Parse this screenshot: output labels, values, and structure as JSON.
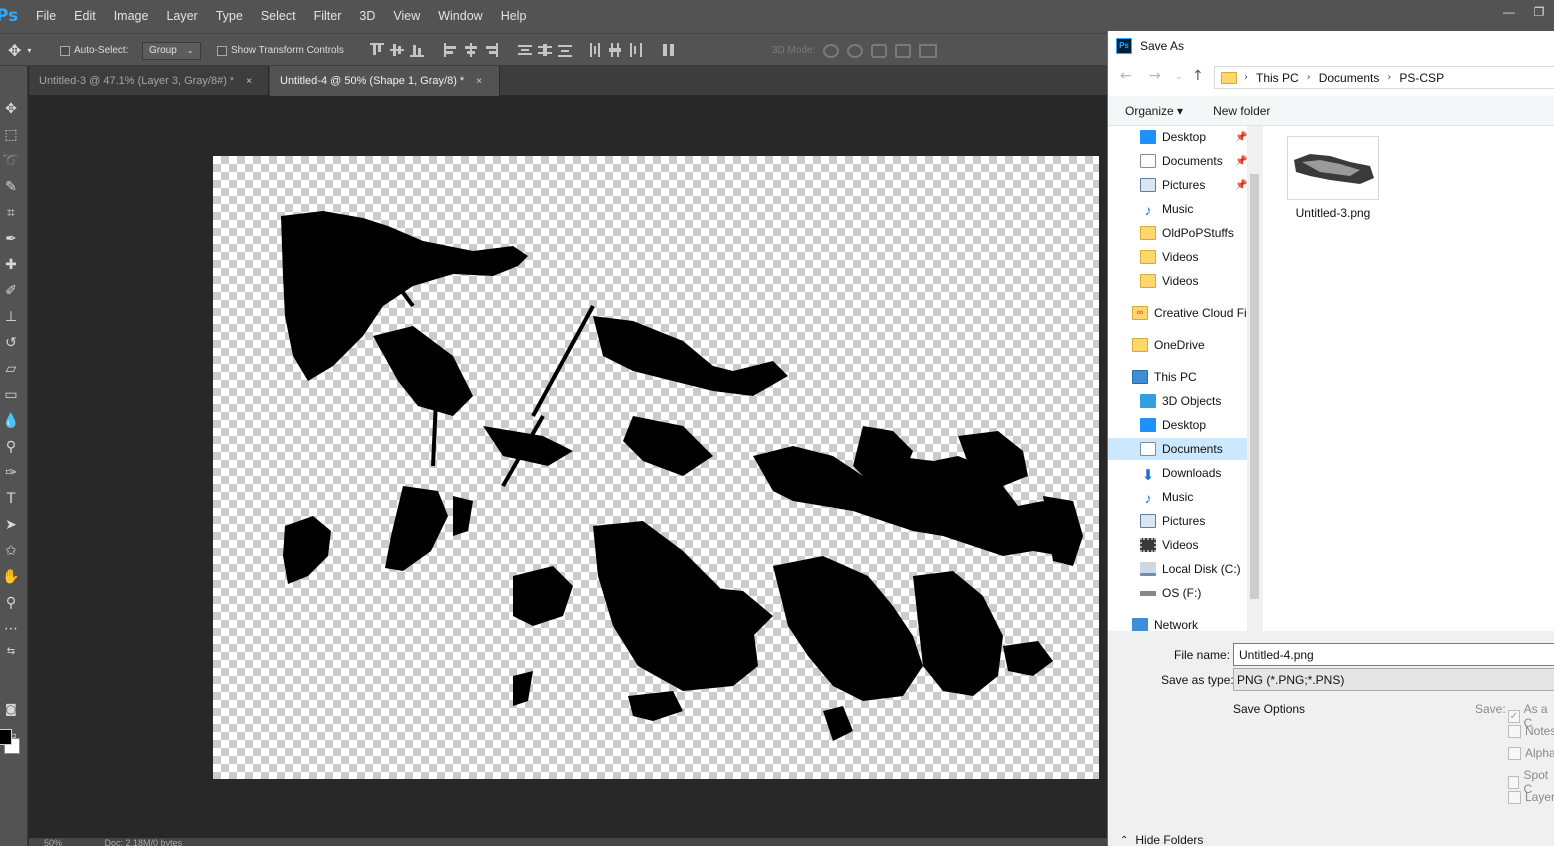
{
  "app": {
    "logo": "Ps",
    "menus": [
      "File",
      "Edit",
      "Image",
      "Layer",
      "Type",
      "Select",
      "Filter",
      "3D",
      "View",
      "Window",
      "Help"
    ],
    "window_buttons": {
      "minimize": "—",
      "restore": "❐"
    }
  },
  "options_bar": {
    "auto_select_label": "Auto-Select:",
    "auto_select_value": "Group",
    "show_transform_label": "Show Transform Controls",
    "mode_3d_label": "3D Mode:"
  },
  "tabs": [
    {
      "label": "Untitled-3 @ 47.1% (Layer 3, Gray/8#) *",
      "close": "×"
    },
    {
      "label": "Untitled-4 @ 50% (Shape 1, Gray/8) *",
      "close": "×"
    }
  ],
  "status": {
    "zoom": "50%",
    "doc": "Doc: 2.18M/0 bytes"
  },
  "dialog": {
    "title": "Save As",
    "icon_text": "Ps",
    "breadcrumb": [
      "This PC",
      "Documents",
      "PS-CSP"
    ],
    "organize_label": "Organize ▾",
    "new_folder_label": "New folder",
    "quick_access": [
      {
        "label": "Desktop",
        "icon": "desktop-icon",
        "color": "#1e90ff",
        "pinned": "📌"
      },
      {
        "label": "Documents",
        "icon": "documents-icon",
        "color": "#7a8ea6",
        "pinned": "📌"
      },
      {
        "label": "Pictures",
        "icon": "pictures-icon",
        "color": "#5a7fa8",
        "pinned": "📌"
      },
      {
        "label": "Music",
        "icon": "music-icon",
        "color": "#2b79d0"
      },
      {
        "label": "OldPoPStuffs",
        "icon": "folder-icon",
        "color": "#ffd86b"
      },
      {
        "label": "Videos",
        "icon": "folder-icon",
        "color": "#ffd86b"
      },
      {
        "label": "Videos",
        "icon": "folder-icon",
        "color": "#ffd86b"
      }
    ],
    "creative_cloud": "Creative Cloud Fil",
    "onedrive": "OneDrive",
    "this_pc": "This PC",
    "this_pc_items": [
      {
        "label": "3D Objects",
        "icon": "3d-objects-icon",
        "color": "#32a0e0"
      },
      {
        "label": "Desktop",
        "icon": "desktop-icon",
        "color": "#1e90ff"
      },
      {
        "label": "Documents",
        "icon": "documents-icon",
        "color": "#7a8ea6",
        "selected": true
      },
      {
        "label": "Downloads",
        "icon": "downloads-icon",
        "color": "#1e73d2"
      },
      {
        "label": "Music",
        "icon": "music-icon",
        "color": "#2b79d0"
      },
      {
        "label": "Pictures",
        "icon": "pictures-icon",
        "color": "#5a7fa8"
      },
      {
        "label": "Videos",
        "icon": "videos-icon",
        "color": "#3a3a3a"
      },
      {
        "label": "Local Disk (C:)",
        "icon": "disk-icon",
        "color": "#6a8fb0"
      },
      {
        "label": "OS (F:)",
        "icon": "drive-icon",
        "color": "#888888"
      }
    ],
    "network": "Network",
    "files": [
      {
        "name": "Untitled-3.png"
      }
    ],
    "file_name_label": "File name:",
    "file_name_value": "Untitled-4.png",
    "save_as_type_label": "Save as type:",
    "save_as_type_value": "PNG (*.PNG;*.PNS)",
    "save_options_label": "Save Options",
    "save_label": "Save:",
    "save_checks": [
      {
        "label": "As a C",
        "checked": true
      },
      {
        "label": "Notes",
        "checked": false
      },
      {
        "label": "Alpha",
        "checked": false
      },
      {
        "label": "Spot C",
        "checked": false
      },
      {
        "label": "Layers",
        "checked": false
      }
    ],
    "hide_folders_label": "Hide Folders"
  }
}
